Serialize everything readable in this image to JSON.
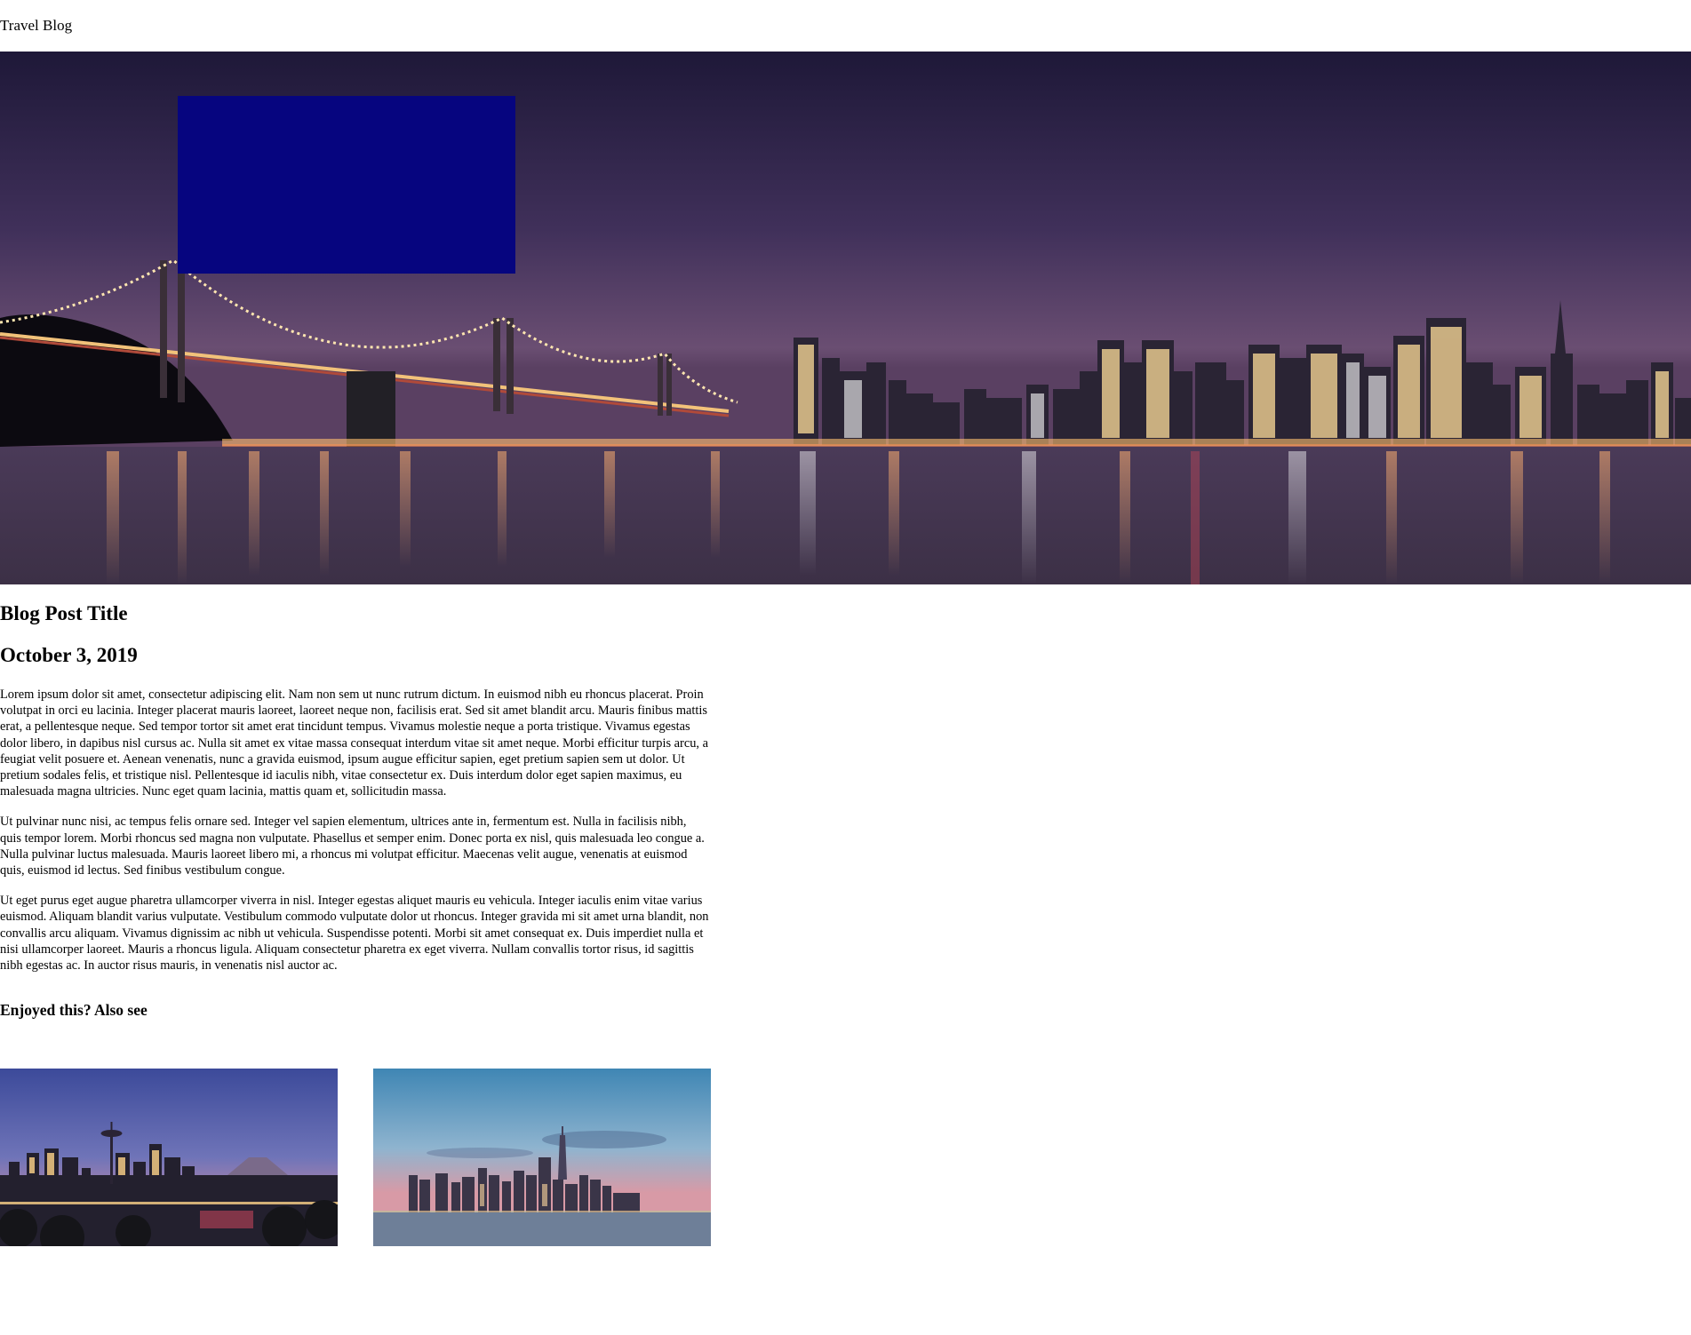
{
  "site": {
    "title": "Travel Blog"
  },
  "hero": {
    "image_alt": "Night skyline with suspension bridge reflected in water"
  },
  "post": {
    "title": "Blog Post Title",
    "date": "October 3, 2019",
    "paragraphs": [
      "Lorem ipsum dolor sit amet, consectetur adipiscing elit. Nam non sem ut nunc rutrum dictum. In euismod nibh eu rhoncus placerat. Proin volutpat in orci eu lacinia. Integer placerat mauris laoreet, laoreet neque non, facilisis erat. Sed sit amet blandit arcu. Mauris finibus mattis erat, a pellentesque neque. Sed tempor tortor sit amet erat tincidunt tempus. Vivamus molestie neque a porta tristique. Vivamus egestas dolor libero, in dapibus nisl cursus ac. Nulla sit amet ex vitae massa consequat interdum vitae sit amet neque. Morbi efficitur turpis arcu, a feugiat velit posuere et. Aenean venenatis, nunc a gravida euismod, ipsum augue efficitur sapien, eget pretium sapien sem ut dolor. Ut pretium sodales felis, et tristique nisl. Pellentesque id iaculis nibh, vitae consectetur ex. Duis interdum dolor eget sapien maximus, eu malesuada magna ultricies. Nunc eget quam lacinia, mattis quam et, sollicitudin massa.",
      "Ut pulvinar nunc nisi, ac tempus felis ornare sed. Integer vel sapien elementum, ultrices ante in, fermentum est. Nulla in facilisis nibh, quis tempor lorem. Morbi rhoncus sed magna non vulputate. Phasellus et semper enim. Donec porta ex nisl, quis malesuada leo congue a. Nulla pulvinar luctus malesuada. Mauris laoreet libero mi, a rhoncus mi volutpat efficitur. Maecenas velit augue, venenatis at euismod quis, euismod id lectus. Sed finibus vestibulum congue.",
      "Ut eget purus eget augue pharetra ullamcorper viverra in nisl. Integer egestas aliquet mauris eu vehicula. Integer iaculis enim vitae varius euismod. Aliquam blandit varius vulputate. Vestibulum commodo vulputate dolor ut rhoncus. Integer gravida mi sit amet urna blandit, non convallis arcu aliquam. Vivamus dignissim ac nibh ut vehicula. Suspendisse potenti. Morbi sit amet consequat ex. Duis imperdiet nulla et nisi ullamcorper laoreet. Mauris a rhoncus ligula. Aliquam consectetur pharetra ex eget viverra. Nullam convallis tortor risus, id sagittis nibh egestas ac. In auctor risus mauris, in venenatis nisl auctor ac."
    ]
  },
  "related": {
    "heading": "Enjoyed this? Also see"
  },
  "colors": {
    "overlay_box": "#06057f",
    "text": "#000000",
    "background": "#ffffff"
  }
}
